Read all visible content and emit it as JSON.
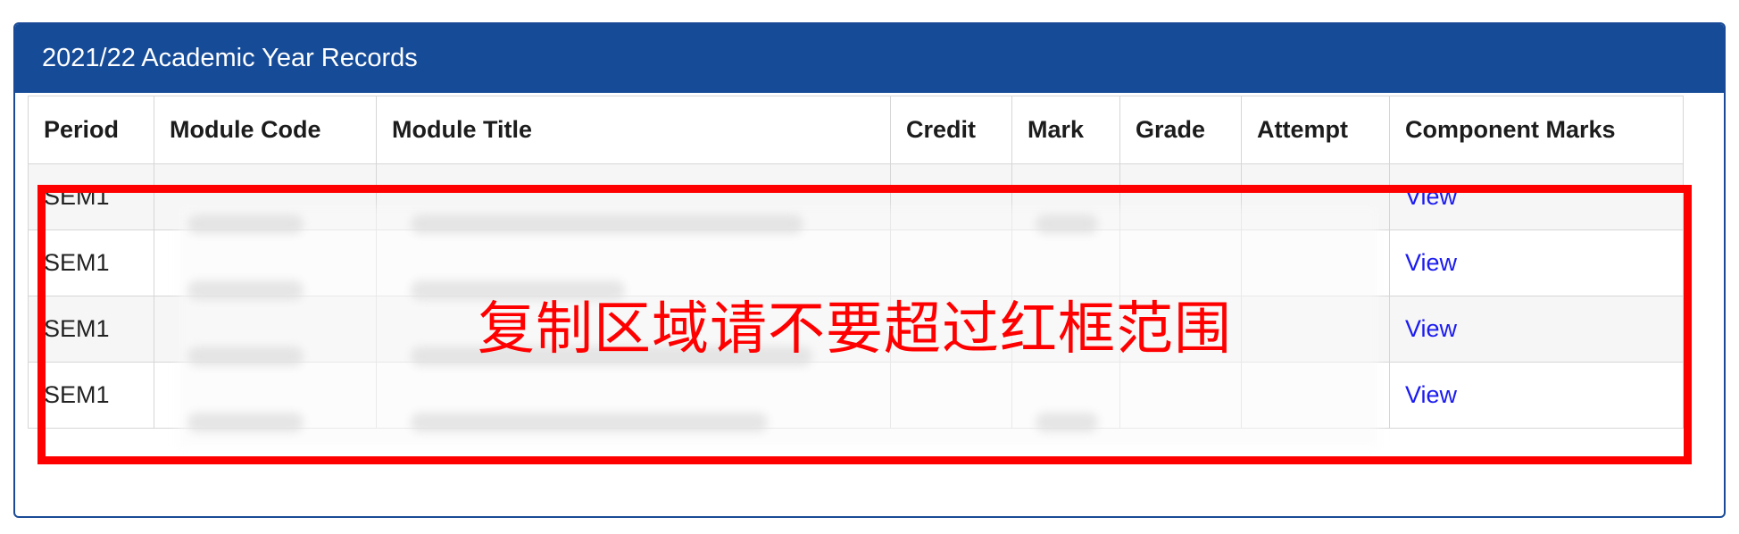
{
  "panel": {
    "title": "2021/22 Academic Year Records"
  },
  "table": {
    "headers": [
      "Period",
      "Module Code",
      "Module Title",
      "Credit",
      "Mark",
      "Grade",
      "Attempt",
      "Component Marks"
    ],
    "rows": [
      {
        "period": "SEM1",
        "component_marks": "View"
      },
      {
        "period": "SEM1",
        "component_marks": "View"
      },
      {
        "period": "SEM1",
        "component_marks": "View"
      },
      {
        "period": "SEM1",
        "component_marks": "View"
      }
    ]
  },
  "annotation": {
    "text": "复制区域请不要超过红框范围",
    "color": "#ff0000"
  },
  "colors": {
    "header_bg": "#164b98",
    "link": "#1b1bf0"
  }
}
